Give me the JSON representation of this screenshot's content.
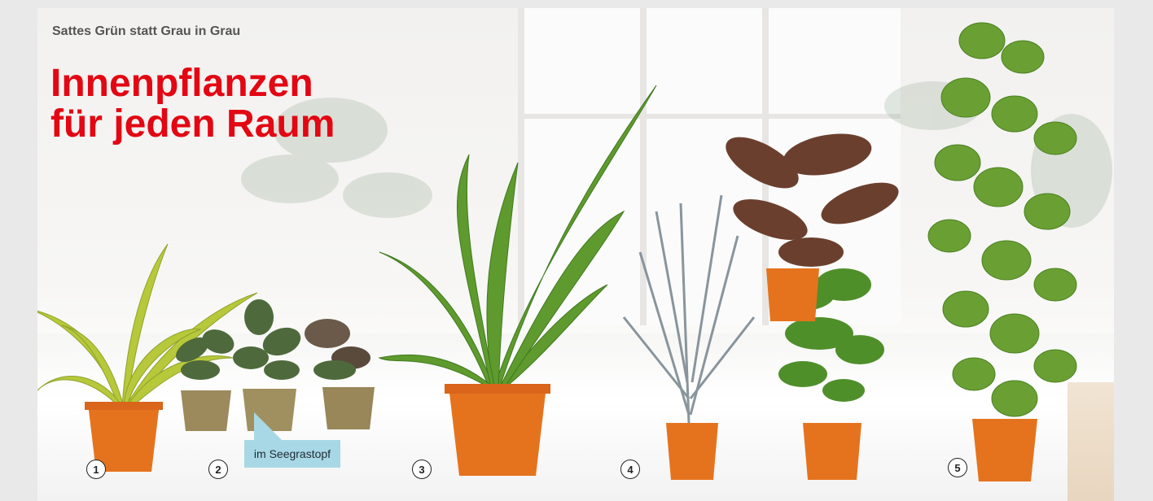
{
  "banner": {
    "kicker": "Sattes Grün statt Grau in Grau",
    "headline_line1": "Innenpflanzen",
    "headline_line2": "für jeden Raum",
    "accent_color": "#e30613",
    "tag_color": "#a8d8e6"
  },
  "products": [
    {
      "number": "1"
    },
    {
      "number": "2",
      "tag": "im Seegrastopf"
    },
    {
      "number": "3"
    },
    {
      "number": "4"
    },
    {
      "number": "5"
    }
  ]
}
